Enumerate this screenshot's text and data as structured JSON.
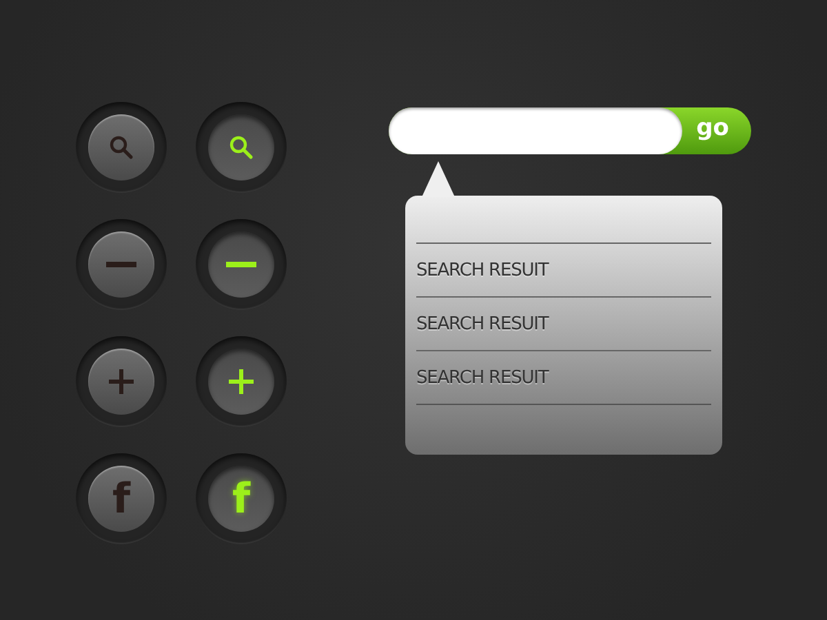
{
  "buttons": [
    {
      "kind": "search",
      "active": false
    },
    {
      "kind": "search",
      "active": true
    },
    {
      "kind": "minus",
      "active": false
    },
    {
      "kind": "minus",
      "active": true
    },
    {
      "kind": "plus",
      "active": false
    },
    {
      "kind": "plus",
      "active": true
    },
    {
      "kind": "letter",
      "label": "f",
      "active": false
    },
    {
      "kind": "letter",
      "label": "f",
      "active": true
    }
  ],
  "search": {
    "button": "go"
  },
  "results": [
    "SEARCH RESUIT",
    "SEARCH RESUIT",
    "SEARCH RESUIT"
  ]
}
